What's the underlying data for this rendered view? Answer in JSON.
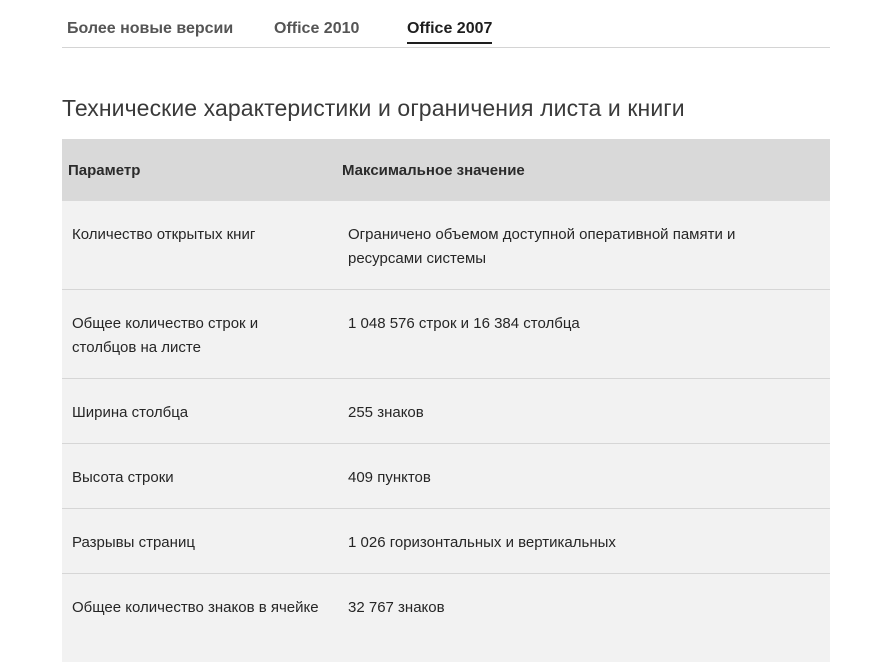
{
  "tabs": [
    {
      "label": "Более новые версии",
      "active": false
    },
    {
      "label": "Office 2010",
      "active": false
    },
    {
      "label": "Office 2007",
      "active": true
    }
  ],
  "heading": "Технические характеристики и ограничения листа и книги",
  "table": {
    "headers": [
      "Параметр",
      "Максимальное значение"
    ],
    "rows": [
      {
        "param": "Количество открытых книг",
        "value": "Ограничено объемом доступной оперативной памяти и ресурсами системы"
      },
      {
        "param": "Общее количество строк и столбцов на листе",
        "value": "1 048 576 строк и 16 384 столбца"
      },
      {
        "param": "Ширина столбца",
        "value": "255 знаков"
      },
      {
        "param": "Высота строки",
        "value": "409 пунктов"
      },
      {
        "param": "Разрывы страниц",
        "value": "1 026 горизонтальных и вертикальных"
      },
      {
        "param": "Общее количество знаков в ячейке",
        "value": "32 767 знаков"
      }
    ]
  }
}
